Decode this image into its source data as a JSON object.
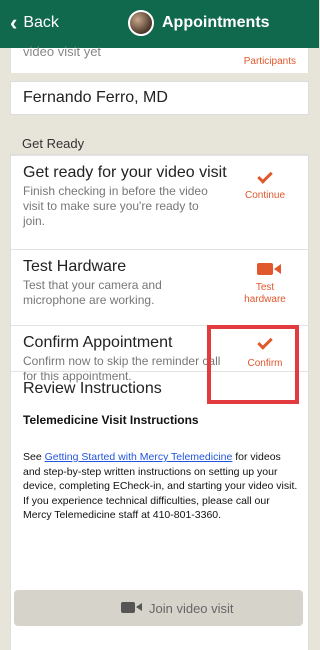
{
  "header": {
    "back_label": "Back",
    "title": "Appointments"
  },
  "top": {
    "cut_text": "video visit yet",
    "participants_label": "Participants"
  },
  "provider": {
    "name": "Fernando Ferro, MD"
  },
  "section": {
    "title": "Get Ready"
  },
  "items": [
    {
      "name": "Get ready for your video visit",
      "desc": "Finish checking in before the video visit to make sure you're ready to join.",
      "action_label": "Continue",
      "icon": "check-icon"
    },
    {
      "name": "Test Hardware",
      "desc": "Test that your camera and microphone are working.",
      "action_label": "Test hardware",
      "icon": "video-camera-icon"
    },
    {
      "name": "Confirm Appointment",
      "desc": "Confirm now to skip the reminder call for this appointment.",
      "action_label": "Confirm",
      "icon": "check-icon"
    }
  ],
  "instructions": {
    "title": "Review Instructions",
    "subtitle": "Telemedicine Visit Instructions",
    "body_prefix": "See ",
    "link_text": "Getting Started with Mercy Telemedicine",
    "body_suffix": " for videos and step-by-step written instructions on setting up your device, completing ECheck-in, and starting your video visit. If you experience technical difficulties, please call our Mercy Telemedicine staff at 410-801-3360."
  },
  "join": {
    "label": "Join video visit"
  },
  "colors": {
    "header": "#10684d",
    "accent": "#e0582c",
    "highlight_box": "#e23b3f",
    "link": "#2255dd"
  }
}
